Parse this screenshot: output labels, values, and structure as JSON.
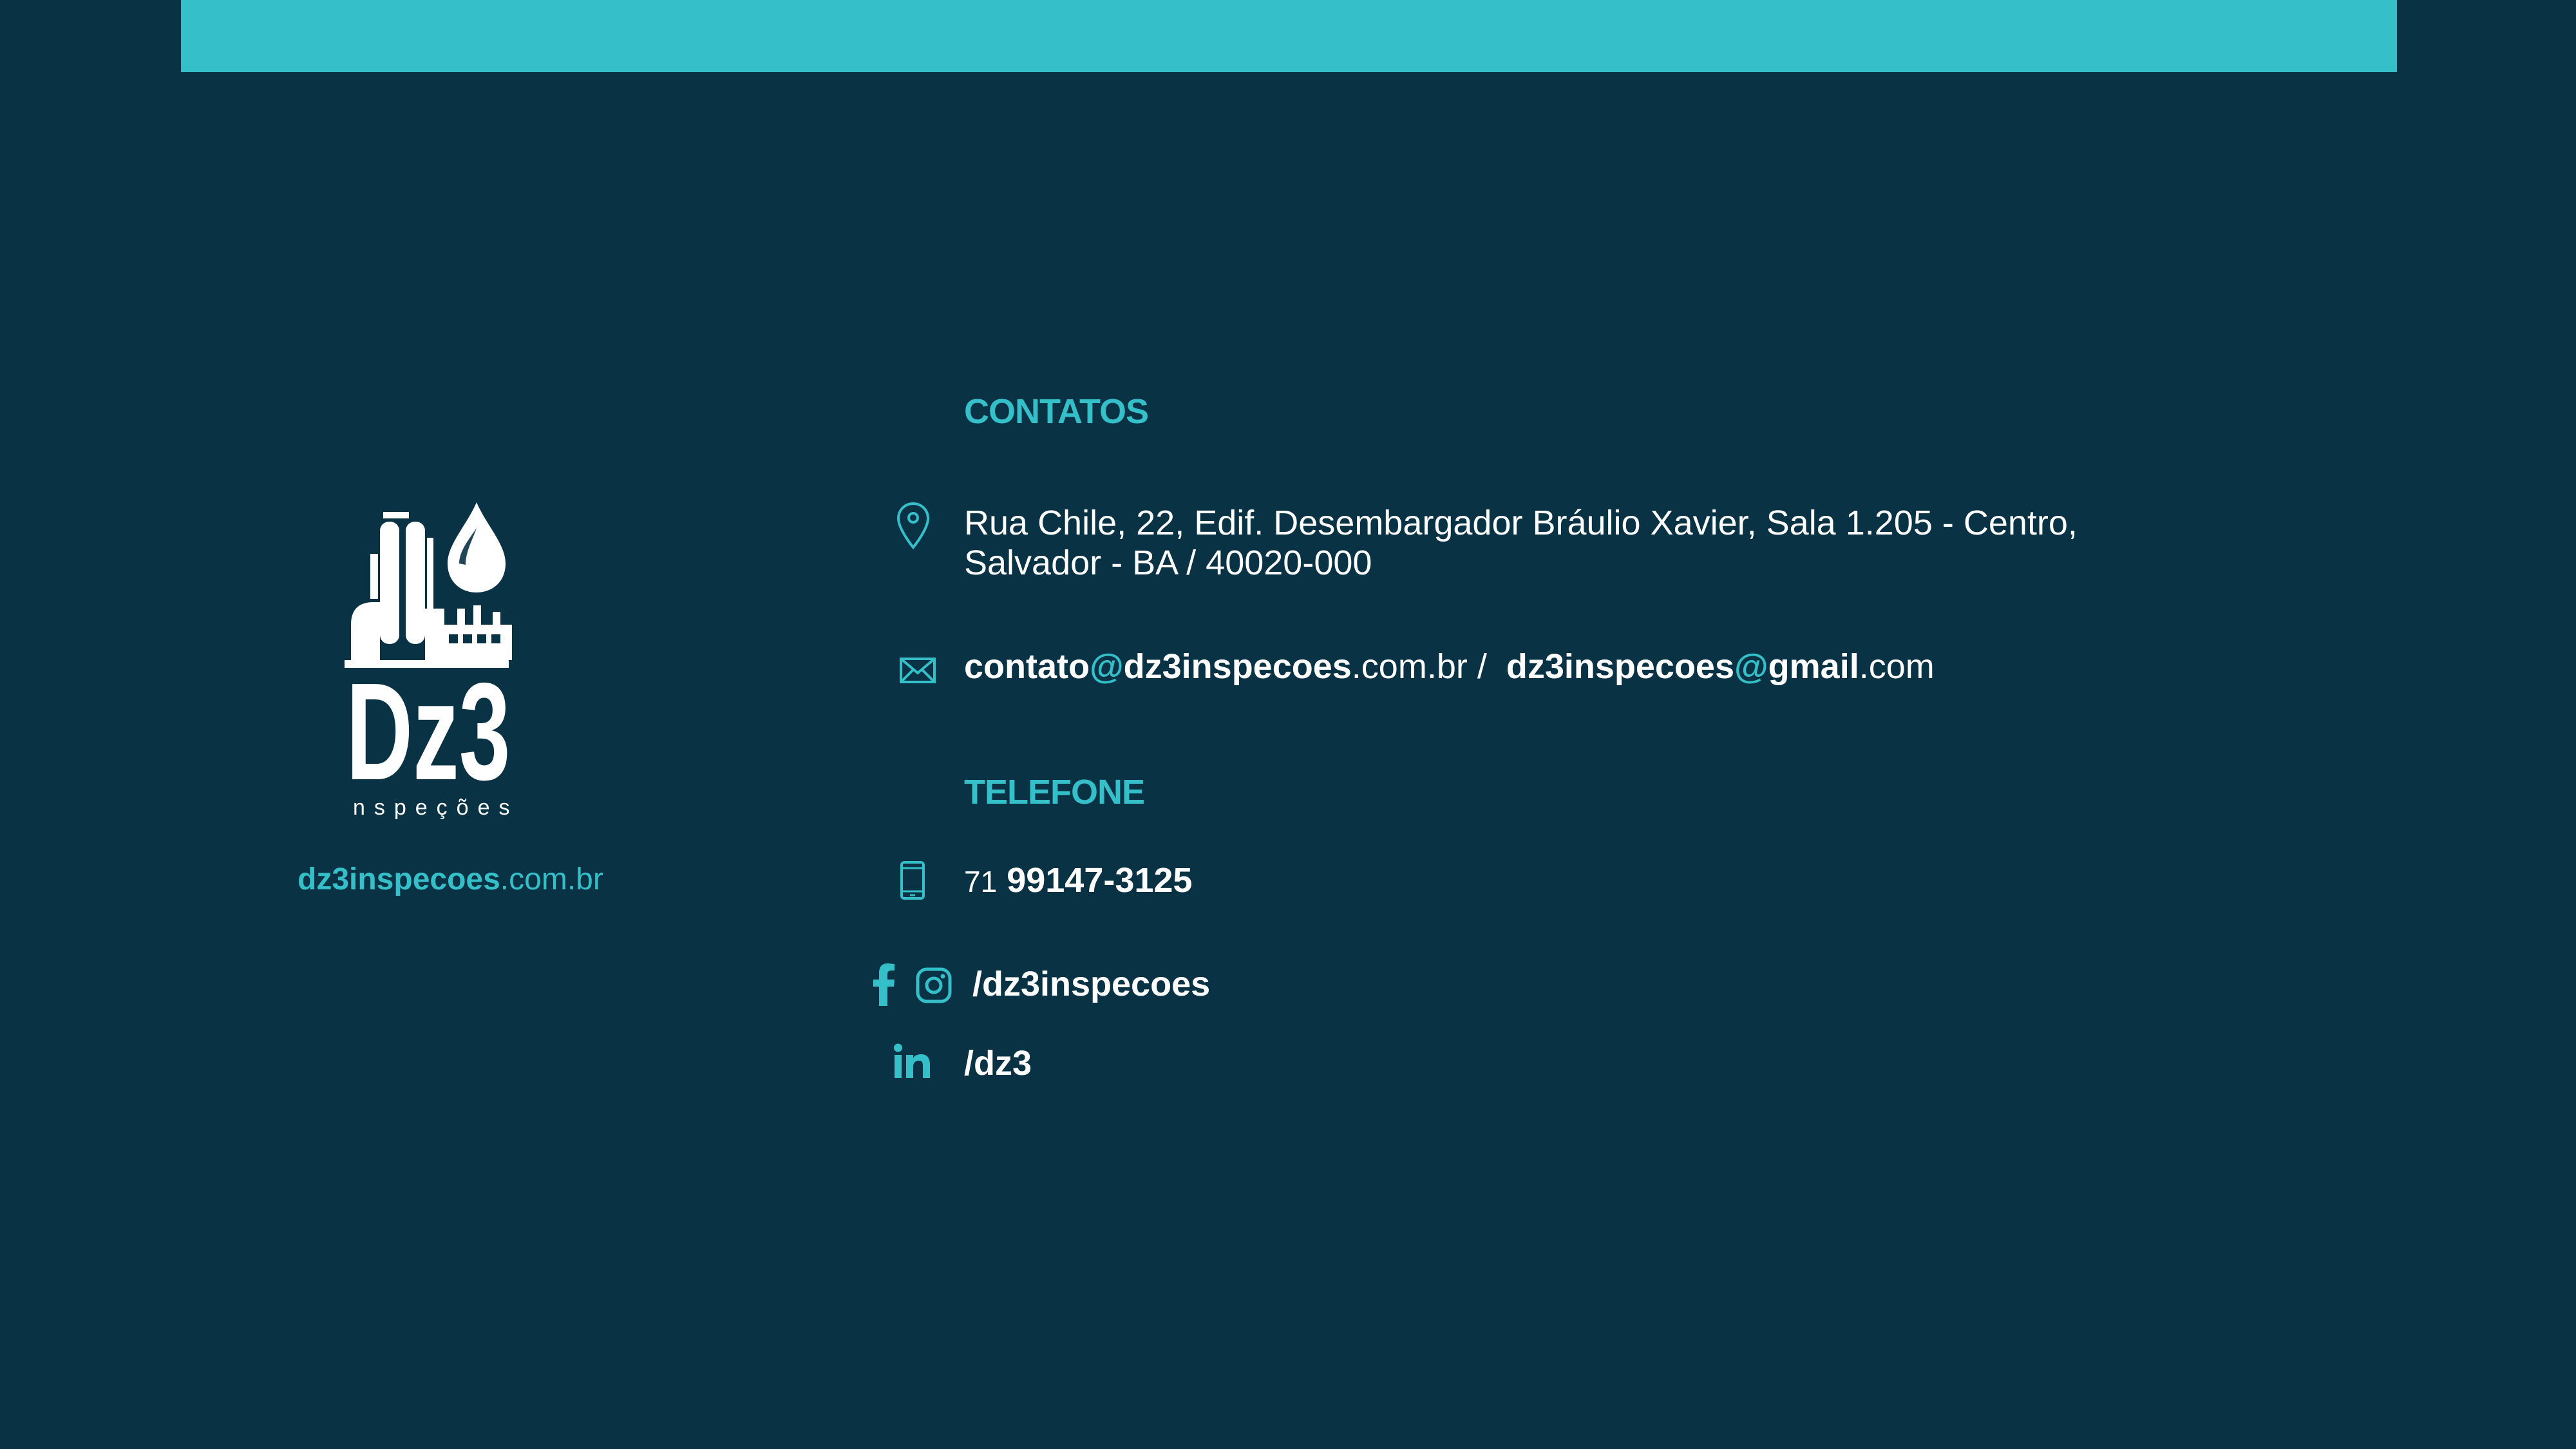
{
  "brand": {
    "logo_wordmark": "Dz3",
    "logo_subtitle": "Inspeções",
    "site_bold": "dz3inspecoes",
    "site_light": ".com.br"
  },
  "contacts": {
    "heading": "CONTATOS",
    "address_line1": "Rua Chile, 22, Edif. Desembargador Bráulio Xavier, Sala 1.205 - Centro,",
    "address_line2": "Salvador - BA  / 40020-000",
    "email1_user": "contato",
    "email1_at": "@",
    "email1_domain": "dz3inspecoes",
    "email1_tld": ".com.br",
    "email_separator": " /  ",
    "email2_user": "dz3inspecoes",
    "email2_at": "@",
    "email2_domain": "gmail",
    "email2_tld": ".com"
  },
  "phone": {
    "heading": "TELEFONE",
    "area_code": "71",
    "number": "99147-3125"
  },
  "social": {
    "facebook_instagram_handle": "/dz3inspecoes",
    "linkedin_handle": "/dz3"
  },
  "icons": {
    "location": "location-pin-icon",
    "email": "envelope-icon",
    "phone": "mobile-phone-icon",
    "facebook": "facebook-icon",
    "instagram": "instagram-icon",
    "linkedin": "linkedin-icon"
  },
  "colors": {
    "background": "#093345",
    "accent": "#35bfc9",
    "text": "#ffffff"
  }
}
